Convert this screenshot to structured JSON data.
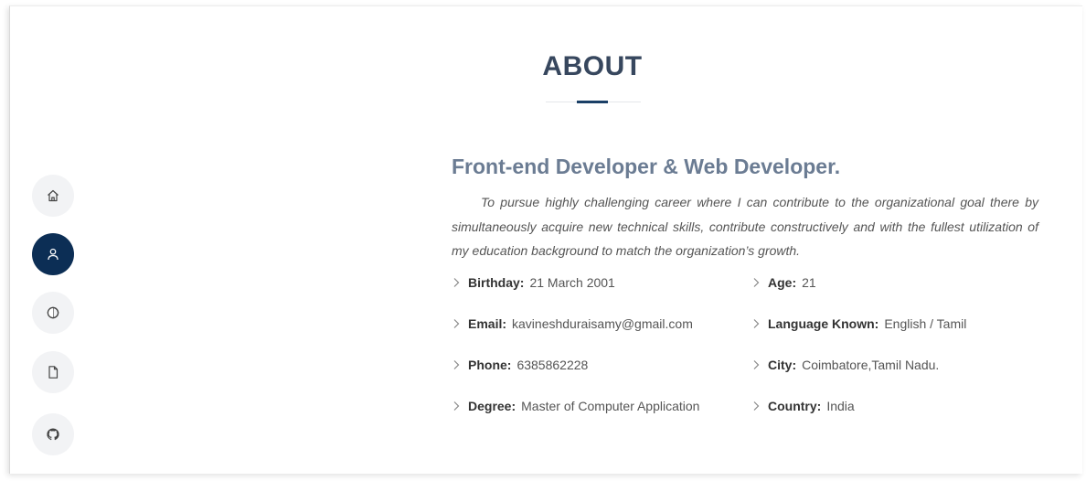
{
  "nav": {
    "items": [
      {
        "id": "home",
        "icon": "home-icon",
        "active": false
      },
      {
        "id": "about",
        "icon": "person-icon",
        "active": true
      },
      {
        "id": "skills",
        "icon": "circle-half-icon",
        "active": false
      },
      {
        "id": "resume",
        "icon": "file-icon",
        "active": false
      },
      {
        "id": "github",
        "icon": "github-icon",
        "active": false
      }
    ],
    "active_color": "#0c2e55",
    "inactive_color": "#f2f3f5"
  },
  "about": {
    "title": "ABOUT",
    "heading": "Front-end Developer & Web Developer.",
    "objective": "To pursue highly challenging career where I can contribute to the organizational goal there by simultaneously acquire new technical skills, contribute constructively and with the fullest utilization of my education background to match the organization’s growth.",
    "left": [
      {
        "label": "Birthday:",
        "value": "21 March 2001"
      },
      {
        "label": "Email:",
        "value": "kavineshduraisamy@gmail.com"
      },
      {
        "label": "Phone:",
        "value": "6385862228"
      },
      {
        "label": "Degree:",
        "value": "Master of Computer Application"
      }
    ],
    "right": [
      {
        "label": "Age:",
        "value": "21"
      },
      {
        "label": "Language Known:",
        "value": "English / Tamil"
      },
      {
        "label": "City:",
        "value": "Coimbatore,Tamil Nadu."
      },
      {
        "label": "Country:",
        "value": "India"
      }
    ]
  },
  "colors": {
    "title": "#37475e",
    "heading": "#6b7c93",
    "accent": "#1a3f66"
  }
}
